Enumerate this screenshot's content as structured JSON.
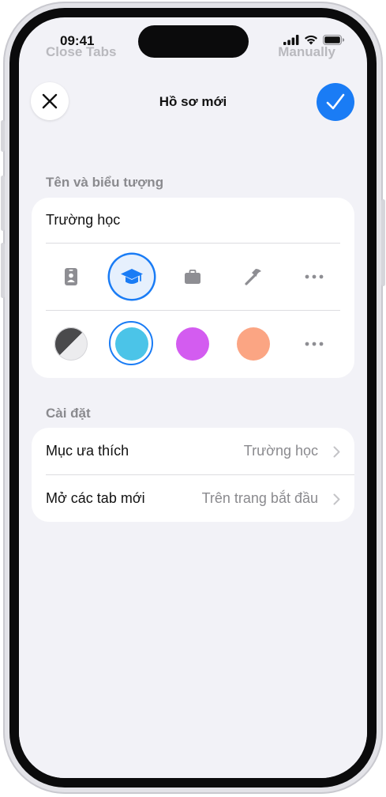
{
  "status_bar": {
    "time": "09:41",
    "icons": [
      "cellular-signal-icon",
      "wifi-icon",
      "battery-icon"
    ]
  },
  "background_peek": {
    "left": "Close Tabs",
    "right": "Manually"
  },
  "header": {
    "title": "Hồ sơ mới",
    "close_icon": "close-icon",
    "done_icon": "checkmark-icon"
  },
  "name_section": {
    "header": "Tên và biểu tượng",
    "name_value": "Trường học",
    "icons": [
      "id-badge-icon",
      "graduation-cap-icon",
      "briefcase-icon",
      "hammer-icon",
      "more-icon"
    ],
    "selected_icon": "graduation-cap-icon",
    "colors": [
      "#4a4a4c",
      "#4bc4e8",
      "#d35cf0",
      "#fba583"
    ],
    "selected_color": "#4bc4e8"
  },
  "settings_section": {
    "header": "Cài đặt",
    "rows": [
      {
        "label": "Mục ưa thích",
        "value": "Trường học"
      },
      {
        "label": "Mở các tab mới",
        "value": "Trên trang bắt đầu"
      }
    ]
  },
  "colors": {
    "accent": "#1a7cf5",
    "background": "#f2f2f7",
    "secondary_text": "#8a8a8e"
  }
}
